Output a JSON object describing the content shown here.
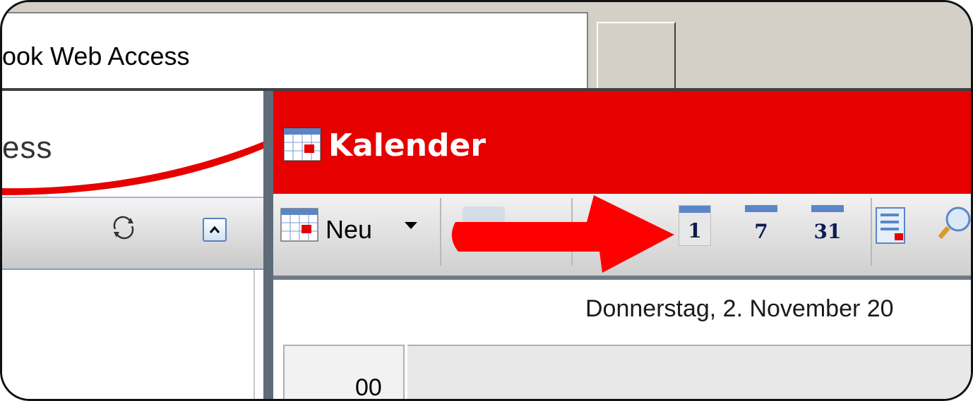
{
  "window": {
    "tab_title": "ook Web Access"
  },
  "left_pane": {
    "brand_text": "ess"
  },
  "header": {
    "title": "Kalender"
  },
  "toolbar": {
    "new_label": "Neu",
    "view_buttons": [
      {
        "label": "1",
        "icon": "day-view-icon"
      },
      {
        "label": "7",
        "icon": "week-view-icon"
      },
      {
        "label": "31",
        "icon": "month-view-icon"
      }
    ]
  },
  "calendar": {
    "date_heading": "Donnerstag, 2. November 20",
    "time_label": "00"
  },
  "colors": {
    "brand_red": "#e60000",
    "arrow_red": "#ff0000",
    "icon_navy": "#0d1b4f"
  }
}
